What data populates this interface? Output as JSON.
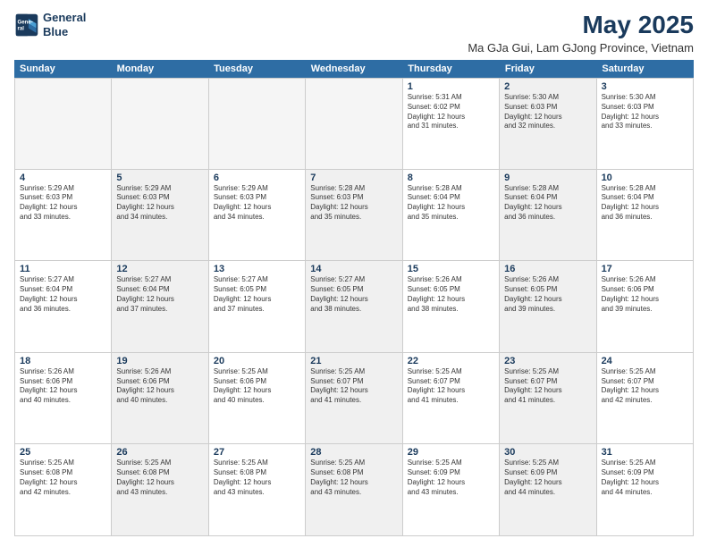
{
  "logo": {
    "line1": "General",
    "line2": "Blue"
  },
  "title": "May 2025",
  "subtitle": "Ma GJa Gui, Lam GJong Province, Vietnam",
  "weekdays": [
    "Sunday",
    "Monday",
    "Tuesday",
    "Wednesday",
    "Thursday",
    "Friday",
    "Saturday"
  ],
  "rows": [
    [
      {
        "day": "",
        "info": "",
        "shaded": true
      },
      {
        "day": "",
        "info": "",
        "shaded": true
      },
      {
        "day": "",
        "info": "",
        "shaded": true
      },
      {
        "day": "",
        "info": "",
        "shaded": true
      },
      {
        "day": "1",
        "info": "Sunrise: 5:31 AM\nSunset: 6:02 PM\nDaylight: 12 hours\nand 31 minutes.",
        "shaded": false
      },
      {
        "day": "2",
        "info": "Sunrise: 5:30 AM\nSunset: 6:03 PM\nDaylight: 12 hours\nand 32 minutes.",
        "shaded": true
      },
      {
        "day": "3",
        "info": "Sunrise: 5:30 AM\nSunset: 6:03 PM\nDaylight: 12 hours\nand 33 minutes.",
        "shaded": false
      }
    ],
    [
      {
        "day": "4",
        "info": "Sunrise: 5:29 AM\nSunset: 6:03 PM\nDaylight: 12 hours\nand 33 minutes.",
        "shaded": false
      },
      {
        "day": "5",
        "info": "Sunrise: 5:29 AM\nSunset: 6:03 PM\nDaylight: 12 hours\nand 34 minutes.",
        "shaded": true
      },
      {
        "day": "6",
        "info": "Sunrise: 5:29 AM\nSunset: 6:03 PM\nDaylight: 12 hours\nand 34 minutes.",
        "shaded": false
      },
      {
        "day": "7",
        "info": "Sunrise: 5:28 AM\nSunset: 6:03 PM\nDaylight: 12 hours\nand 35 minutes.",
        "shaded": true
      },
      {
        "day": "8",
        "info": "Sunrise: 5:28 AM\nSunset: 6:04 PM\nDaylight: 12 hours\nand 35 minutes.",
        "shaded": false
      },
      {
        "day": "9",
        "info": "Sunrise: 5:28 AM\nSunset: 6:04 PM\nDaylight: 12 hours\nand 36 minutes.",
        "shaded": true
      },
      {
        "day": "10",
        "info": "Sunrise: 5:28 AM\nSunset: 6:04 PM\nDaylight: 12 hours\nand 36 minutes.",
        "shaded": false
      }
    ],
    [
      {
        "day": "11",
        "info": "Sunrise: 5:27 AM\nSunset: 6:04 PM\nDaylight: 12 hours\nand 36 minutes.",
        "shaded": false
      },
      {
        "day": "12",
        "info": "Sunrise: 5:27 AM\nSunset: 6:04 PM\nDaylight: 12 hours\nand 37 minutes.",
        "shaded": true
      },
      {
        "day": "13",
        "info": "Sunrise: 5:27 AM\nSunset: 6:05 PM\nDaylight: 12 hours\nand 37 minutes.",
        "shaded": false
      },
      {
        "day": "14",
        "info": "Sunrise: 5:27 AM\nSunset: 6:05 PM\nDaylight: 12 hours\nand 38 minutes.",
        "shaded": true
      },
      {
        "day": "15",
        "info": "Sunrise: 5:26 AM\nSunset: 6:05 PM\nDaylight: 12 hours\nand 38 minutes.",
        "shaded": false
      },
      {
        "day": "16",
        "info": "Sunrise: 5:26 AM\nSunset: 6:05 PM\nDaylight: 12 hours\nand 39 minutes.",
        "shaded": true
      },
      {
        "day": "17",
        "info": "Sunrise: 5:26 AM\nSunset: 6:06 PM\nDaylight: 12 hours\nand 39 minutes.",
        "shaded": false
      }
    ],
    [
      {
        "day": "18",
        "info": "Sunrise: 5:26 AM\nSunset: 6:06 PM\nDaylight: 12 hours\nand 40 minutes.",
        "shaded": false
      },
      {
        "day": "19",
        "info": "Sunrise: 5:26 AM\nSunset: 6:06 PM\nDaylight: 12 hours\nand 40 minutes.",
        "shaded": true
      },
      {
        "day": "20",
        "info": "Sunrise: 5:25 AM\nSunset: 6:06 PM\nDaylight: 12 hours\nand 40 minutes.",
        "shaded": false
      },
      {
        "day": "21",
        "info": "Sunrise: 5:25 AM\nSunset: 6:07 PM\nDaylight: 12 hours\nand 41 minutes.",
        "shaded": true
      },
      {
        "day": "22",
        "info": "Sunrise: 5:25 AM\nSunset: 6:07 PM\nDaylight: 12 hours\nand 41 minutes.",
        "shaded": false
      },
      {
        "day": "23",
        "info": "Sunrise: 5:25 AM\nSunset: 6:07 PM\nDaylight: 12 hours\nand 41 minutes.",
        "shaded": true
      },
      {
        "day": "24",
        "info": "Sunrise: 5:25 AM\nSunset: 6:07 PM\nDaylight: 12 hours\nand 42 minutes.",
        "shaded": false
      }
    ],
    [
      {
        "day": "25",
        "info": "Sunrise: 5:25 AM\nSunset: 6:08 PM\nDaylight: 12 hours\nand 42 minutes.",
        "shaded": false
      },
      {
        "day": "26",
        "info": "Sunrise: 5:25 AM\nSunset: 6:08 PM\nDaylight: 12 hours\nand 43 minutes.",
        "shaded": true
      },
      {
        "day": "27",
        "info": "Sunrise: 5:25 AM\nSunset: 6:08 PM\nDaylight: 12 hours\nand 43 minutes.",
        "shaded": false
      },
      {
        "day": "28",
        "info": "Sunrise: 5:25 AM\nSunset: 6:08 PM\nDaylight: 12 hours\nand 43 minutes.",
        "shaded": true
      },
      {
        "day": "29",
        "info": "Sunrise: 5:25 AM\nSunset: 6:09 PM\nDaylight: 12 hours\nand 43 minutes.",
        "shaded": false
      },
      {
        "day": "30",
        "info": "Sunrise: 5:25 AM\nSunset: 6:09 PM\nDaylight: 12 hours\nand 44 minutes.",
        "shaded": true
      },
      {
        "day": "31",
        "info": "Sunrise: 5:25 AM\nSunset: 6:09 PM\nDaylight: 12 hours\nand 44 minutes.",
        "shaded": false
      }
    ]
  ]
}
